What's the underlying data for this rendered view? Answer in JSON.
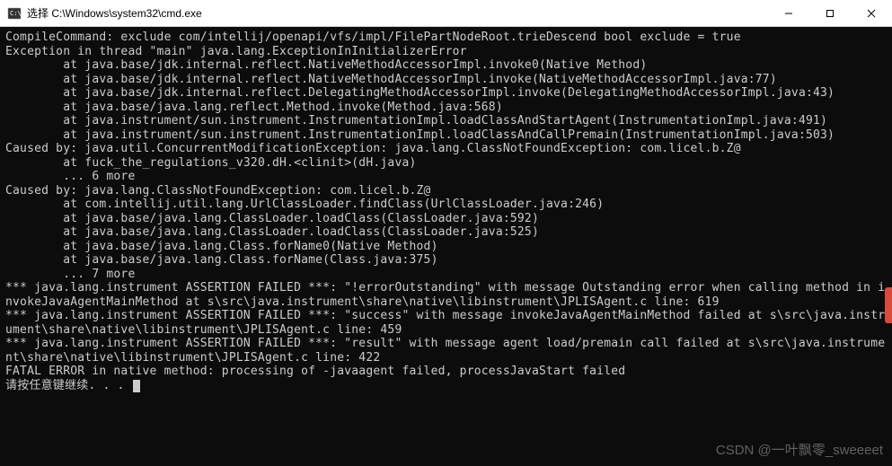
{
  "titlebar": {
    "title": "选择 C:\\Windows\\system32\\cmd.exe"
  },
  "window_controls": {
    "minimize": "–",
    "maximize": "□",
    "close": "✕"
  },
  "terminal": {
    "lines": [
      "CompileCommand: exclude com/intellij/openapi/vfs/impl/FilePartNodeRoot.trieDescend bool exclude = true",
      "Exception in thread \"main\" java.lang.ExceptionInInitializerError",
      "        at java.base/jdk.internal.reflect.NativeMethodAccessorImpl.invoke0(Native Method)",
      "        at java.base/jdk.internal.reflect.NativeMethodAccessorImpl.invoke(NativeMethodAccessorImpl.java:77)",
      "        at java.base/jdk.internal.reflect.DelegatingMethodAccessorImpl.invoke(DelegatingMethodAccessorImpl.java:43)",
      "        at java.base/java.lang.reflect.Method.invoke(Method.java:568)",
      "        at java.instrument/sun.instrument.InstrumentationImpl.loadClassAndStartAgent(InstrumentationImpl.java:491)",
      "        at java.instrument/sun.instrument.InstrumentationImpl.loadClassAndCallPremain(InstrumentationImpl.java:503)",
      "Caused by: java.util.ConcurrentModificationException: java.lang.ClassNotFoundException: com.licel.b.Z@",
      "        at fuck_the_regulations_v320.dH.<clinit>(dH.java)",
      "        ... 6 more",
      "Caused by: java.lang.ClassNotFoundException: com.licel.b.Z@",
      "        at com.intellij.util.lang.UrlClassLoader.findClass(UrlClassLoader.java:246)",
      "        at java.base/java.lang.ClassLoader.loadClass(ClassLoader.java:592)",
      "        at java.base/java.lang.ClassLoader.loadClass(ClassLoader.java:525)",
      "        at java.base/java.lang.Class.forName0(Native Method)",
      "        at java.base/java.lang.Class.forName(Class.java:375)",
      "        ... 7 more",
      "*** java.lang.instrument ASSERTION FAILED ***: \"!errorOutstanding\" with message Outstanding error when calling method in invokeJavaAgentMainMethod at s\\src\\java.instrument\\share\\native\\libinstrument\\JPLISAgent.c line: 619",
      "*** java.lang.instrument ASSERTION FAILED ***: \"success\" with message invokeJavaAgentMainMethod failed at s\\src\\java.instrument\\share\\native\\libinstrument\\JPLISAgent.c line: 459",
      "*** java.lang.instrument ASSERTION FAILED ***: \"result\" with message agent load/premain call failed at s\\src\\java.instrument\\share\\native\\libinstrument\\JPLISAgent.c line: 422",
      "FATAL ERROR in native method: processing of -javaagent failed, processJavaStart failed"
    ],
    "prompt": "请按任意键继续. . . "
  },
  "watermark": "CSDN @一叶飘零_sweeeet"
}
